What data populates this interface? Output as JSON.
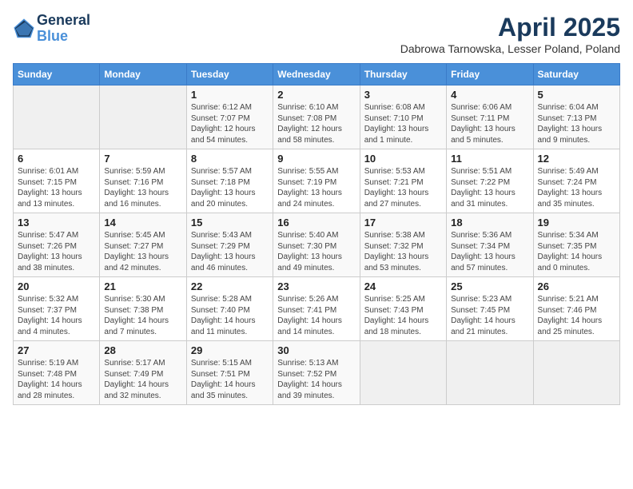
{
  "header": {
    "logo_line1": "General",
    "logo_line2": "Blue",
    "month_title": "April 2025",
    "location": "Dabrowa Tarnowska, Lesser Poland, Poland"
  },
  "days_of_week": [
    "Sunday",
    "Monday",
    "Tuesday",
    "Wednesday",
    "Thursday",
    "Friday",
    "Saturday"
  ],
  "weeks": [
    [
      {
        "day": "",
        "info": ""
      },
      {
        "day": "",
        "info": ""
      },
      {
        "day": "1",
        "info": "Sunrise: 6:12 AM\nSunset: 7:07 PM\nDaylight: 12 hours and 54 minutes."
      },
      {
        "day": "2",
        "info": "Sunrise: 6:10 AM\nSunset: 7:08 PM\nDaylight: 12 hours and 58 minutes."
      },
      {
        "day": "3",
        "info": "Sunrise: 6:08 AM\nSunset: 7:10 PM\nDaylight: 13 hours and 1 minute."
      },
      {
        "day": "4",
        "info": "Sunrise: 6:06 AM\nSunset: 7:11 PM\nDaylight: 13 hours and 5 minutes."
      },
      {
        "day": "5",
        "info": "Sunrise: 6:04 AM\nSunset: 7:13 PM\nDaylight: 13 hours and 9 minutes."
      }
    ],
    [
      {
        "day": "6",
        "info": "Sunrise: 6:01 AM\nSunset: 7:15 PM\nDaylight: 13 hours and 13 minutes."
      },
      {
        "day": "7",
        "info": "Sunrise: 5:59 AM\nSunset: 7:16 PM\nDaylight: 13 hours and 16 minutes."
      },
      {
        "day": "8",
        "info": "Sunrise: 5:57 AM\nSunset: 7:18 PM\nDaylight: 13 hours and 20 minutes."
      },
      {
        "day": "9",
        "info": "Sunrise: 5:55 AM\nSunset: 7:19 PM\nDaylight: 13 hours and 24 minutes."
      },
      {
        "day": "10",
        "info": "Sunrise: 5:53 AM\nSunset: 7:21 PM\nDaylight: 13 hours and 27 minutes."
      },
      {
        "day": "11",
        "info": "Sunrise: 5:51 AM\nSunset: 7:22 PM\nDaylight: 13 hours and 31 minutes."
      },
      {
        "day": "12",
        "info": "Sunrise: 5:49 AM\nSunset: 7:24 PM\nDaylight: 13 hours and 35 minutes."
      }
    ],
    [
      {
        "day": "13",
        "info": "Sunrise: 5:47 AM\nSunset: 7:26 PM\nDaylight: 13 hours and 38 minutes."
      },
      {
        "day": "14",
        "info": "Sunrise: 5:45 AM\nSunset: 7:27 PM\nDaylight: 13 hours and 42 minutes."
      },
      {
        "day": "15",
        "info": "Sunrise: 5:43 AM\nSunset: 7:29 PM\nDaylight: 13 hours and 46 minutes."
      },
      {
        "day": "16",
        "info": "Sunrise: 5:40 AM\nSunset: 7:30 PM\nDaylight: 13 hours and 49 minutes."
      },
      {
        "day": "17",
        "info": "Sunrise: 5:38 AM\nSunset: 7:32 PM\nDaylight: 13 hours and 53 minutes."
      },
      {
        "day": "18",
        "info": "Sunrise: 5:36 AM\nSunset: 7:34 PM\nDaylight: 13 hours and 57 minutes."
      },
      {
        "day": "19",
        "info": "Sunrise: 5:34 AM\nSunset: 7:35 PM\nDaylight: 14 hours and 0 minutes."
      }
    ],
    [
      {
        "day": "20",
        "info": "Sunrise: 5:32 AM\nSunset: 7:37 PM\nDaylight: 14 hours and 4 minutes."
      },
      {
        "day": "21",
        "info": "Sunrise: 5:30 AM\nSunset: 7:38 PM\nDaylight: 14 hours and 7 minutes."
      },
      {
        "day": "22",
        "info": "Sunrise: 5:28 AM\nSunset: 7:40 PM\nDaylight: 14 hours and 11 minutes."
      },
      {
        "day": "23",
        "info": "Sunrise: 5:26 AM\nSunset: 7:41 PM\nDaylight: 14 hours and 14 minutes."
      },
      {
        "day": "24",
        "info": "Sunrise: 5:25 AM\nSunset: 7:43 PM\nDaylight: 14 hours and 18 minutes."
      },
      {
        "day": "25",
        "info": "Sunrise: 5:23 AM\nSunset: 7:45 PM\nDaylight: 14 hours and 21 minutes."
      },
      {
        "day": "26",
        "info": "Sunrise: 5:21 AM\nSunset: 7:46 PM\nDaylight: 14 hours and 25 minutes."
      }
    ],
    [
      {
        "day": "27",
        "info": "Sunrise: 5:19 AM\nSunset: 7:48 PM\nDaylight: 14 hours and 28 minutes."
      },
      {
        "day": "28",
        "info": "Sunrise: 5:17 AM\nSunset: 7:49 PM\nDaylight: 14 hours and 32 minutes."
      },
      {
        "day": "29",
        "info": "Sunrise: 5:15 AM\nSunset: 7:51 PM\nDaylight: 14 hours and 35 minutes."
      },
      {
        "day": "30",
        "info": "Sunrise: 5:13 AM\nSunset: 7:52 PM\nDaylight: 14 hours and 39 minutes."
      },
      {
        "day": "",
        "info": ""
      },
      {
        "day": "",
        "info": ""
      },
      {
        "day": "",
        "info": ""
      }
    ]
  ]
}
